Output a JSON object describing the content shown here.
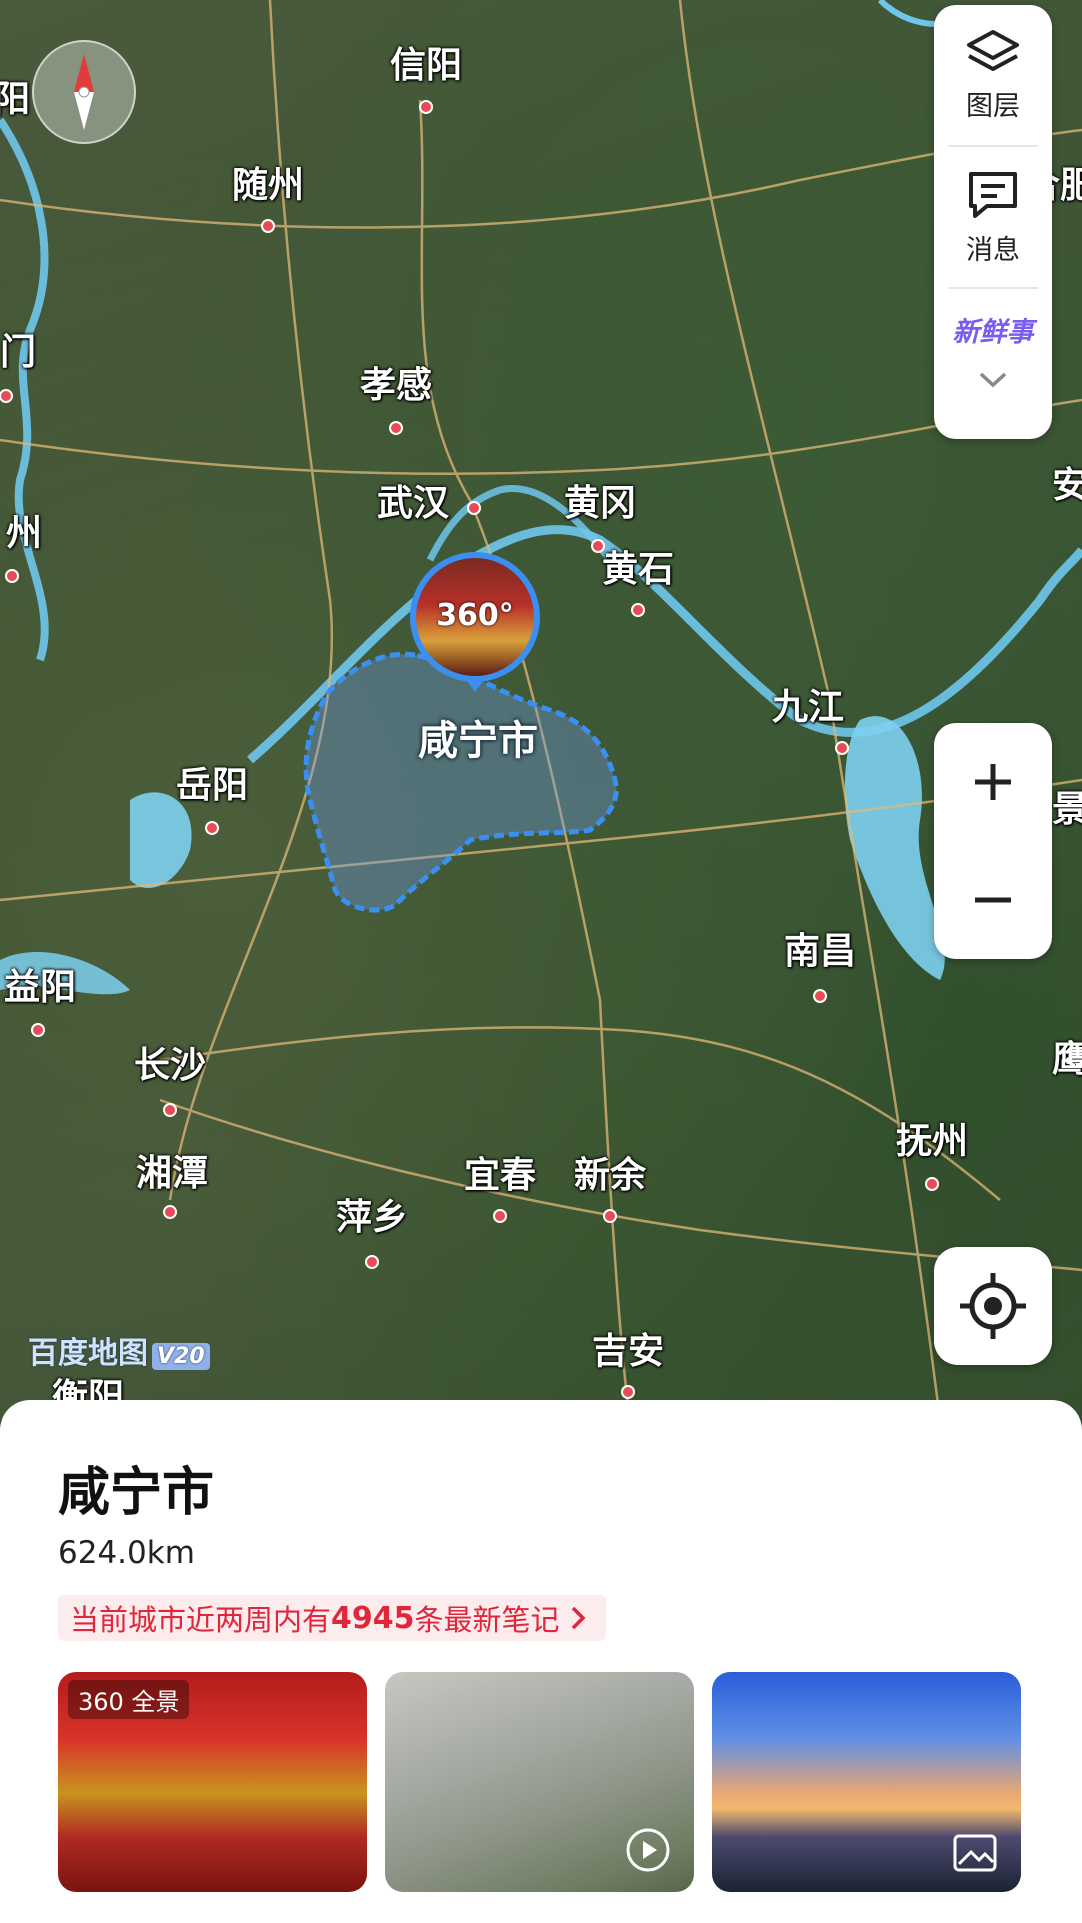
{
  "map": {
    "cities": [
      {
        "name": "信阳"
      },
      {
        "name": "随州"
      },
      {
        "name": "阳"
      },
      {
        "name": "门"
      },
      {
        "name": "孝感"
      },
      {
        "name": "武汉"
      },
      {
        "name": "黄冈"
      },
      {
        "name": "黄石"
      },
      {
        "name": "州"
      },
      {
        "name": "九江"
      },
      {
        "name": "岳阳"
      },
      {
        "name": "南昌"
      },
      {
        "name": "益阳"
      },
      {
        "name": "长沙"
      },
      {
        "name": "湘潭"
      },
      {
        "name": "宜春"
      },
      {
        "name": "新余"
      },
      {
        "name": "萍乡"
      },
      {
        "name": "抚州"
      },
      {
        "name": "吉安"
      },
      {
        "name": "衡阳"
      },
      {
        "name": "合肥"
      },
      {
        "name": "安"
      },
      {
        "name": "景"
      },
      {
        "name": "鹰"
      }
    ],
    "highlighted_region": "咸宁市",
    "pano_badge": "360°",
    "watermark_text": "百度地图",
    "watermark_version": "V20",
    "colors": {
      "region_border": "#3a8ff0",
      "city_dot": "#e64b57"
    }
  },
  "tools": {
    "layers_label": "图层",
    "messages_label": "消息",
    "fresh_label": "新鲜事",
    "icons": [
      "layers-icon",
      "message-icon",
      "chevron-down-icon",
      "zoom-in-icon",
      "zoom-out-icon",
      "locate-icon",
      "compass-icon"
    ]
  },
  "sheet": {
    "title": "咸宁市",
    "distance": "624.0km",
    "notes_prefix": "当前城市近两周内有",
    "notes_count": "4945",
    "notes_suffix": "条最新笔记",
    "photos": [
      {
        "tag": "全景",
        "tag_badge": "360"
      },
      {
        "icon": "play-icon"
      },
      {
        "icon": "image-icon"
      }
    ]
  }
}
